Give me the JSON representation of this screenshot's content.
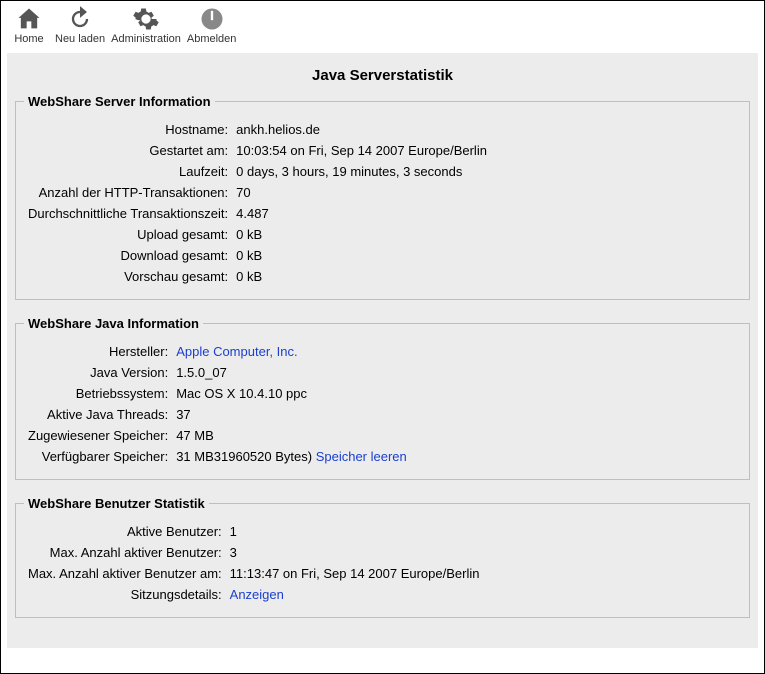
{
  "toolbar": {
    "home": "Home",
    "reload": "Neu laden",
    "admin": "Administration",
    "logout": "Abmelden"
  },
  "page_title": "Java Serverstatistik",
  "server_info": {
    "legend": "WebShare Server Information",
    "rows": [
      {
        "label": "Hostname:",
        "value": "ankh.helios.de"
      },
      {
        "label": "Gestartet am:",
        "value": "10:03:54 on Fri, Sep 14 2007 Europe/Berlin"
      },
      {
        "label": "Laufzeit:",
        "value": "0 days, 3 hours, 19 minutes, 3 seconds"
      },
      {
        "label": "Anzahl der HTTP-Transaktionen:",
        "value": "70"
      },
      {
        "label": "Durchschnittliche Transaktionszeit:",
        "value": "4.487"
      },
      {
        "label": "Upload gesamt:",
        "value": "0 kB"
      },
      {
        "label": "Download gesamt:",
        "value": "0 kB"
      },
      {
        "label": "Vorschau gesamt:",
        "value": "0 kB"
      }
    ]
  },
  "java_info": {
    "legend": "WebShare Java Information",
    "rows": [
      {
        "label": "Hersteller:",
        "value": "Apple Computer, Inc.",
        "link": true
      },
      {
        "label": "Java Version:",
        "value": "1.5.0_07"
      },
      {
        "label": "Betriebssystem:",
        "value": "Mac OS X 10.4.10 ppc"
      },
      {
        "label": "Aktive Java Threads:",
        "value": "37"
      },
      {
        "label": "Zugewiesener Speicher:",
        "value": "47 MB"
      },
      {
        "label": "Verfügbarer Speicher:",
        "value": "31 MB31960520 Bytes)",
        "action": "Speicher leeren"
      }
    ]
  },
  "user_stats": {
    "legend": "WebShare Benutzer Statistik",
    "rows": [
      {
        "label": "Aktive Benutzer:",
        "value": "1"
      },
      {
        "label": "Max. Anzahl aktiver Benutzer:",
        "value": "3"
      },
      {
        "label": "Max. Anzahl aktiver Benutzer am:",
        "value": "11:13:47 on Fri, Sep 14 2007 Europe/Berlin"
      },
      {
        "label": "Sitzungsdetails:",
        "value": "Anzeigen",
        "link": true
      }
    ]
  }
}
